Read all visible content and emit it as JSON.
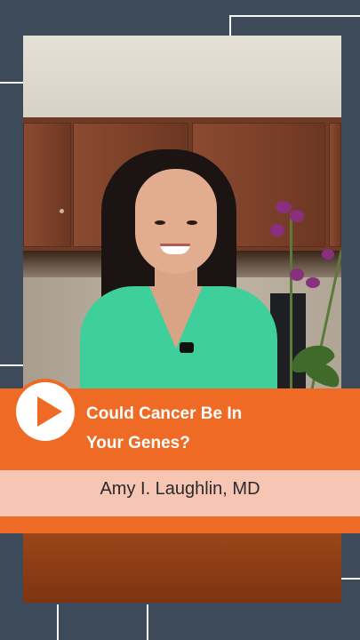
{
  "video": {
    "title": "Could Cancer Be In Your Genes?",
    "title_line1": "Could Cancer Be In",
    "title_line2": "Your Genes?",
    "presenter": "Amy I. Laughlin, MD"
  },
  "colors": {
    "background": "#3d4a5a",
    "accent_orange": "#ee6a25",
    "name_bar": "#f7c5b4",
    "title_text": "#ffffff"
  },
  "icons": {
    "play": "play-icon"
  }
}
